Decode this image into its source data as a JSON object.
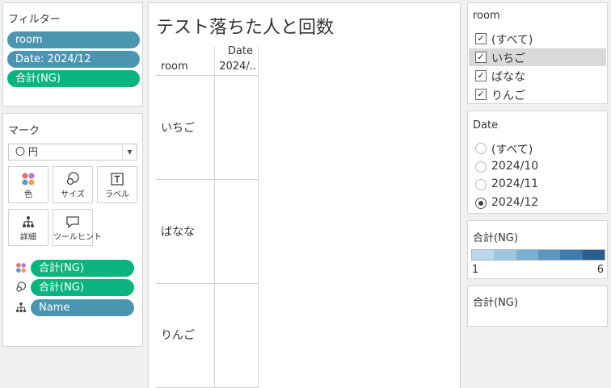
{
  "filters": {
    "title": "フィルター",
    "items": [
      "room",
      "Date: 2024/12",
      "合計(NG)"
    ]
  },
  "marks": {
    "title": "マーク",
    "mark_type": "〇 円",
    "cards": [
      "色",
      "サイズ",
      "ラベル",
      "詳細",
      "ツールヒント"
    ],
    "fields": [
      "合計(NG)",
      "合計(NG)",
      "Name"
    ]
  },
  "view": {
    "title": "テスト落ちた人と回数",
    "row_header": "room",
    "col_header_line1": "Date",
    "col_header_line2": "2024/..",
    "rows": [
      "いちご",
      "ばなな",
      "りんご"
    ]
  },
  "room_filter": {
    "title": "room",
    "options": [
      {
        "label": "(すべて)",
        "checked": true
      },
      {
        "label": "いちご",
        "checked": true
      },
      {
        "label": "ばなな",
        "checked": true
      },
      {
        "label": "りんご",
        "checked": true
      }
    ],
    "check_mark": "✓"
  },
  "date_filter": {
    "title": "Date",
    "options": [
      {
        "label": "(すべて)",
        "selected": false
      },
      {
        "label": "2024/10",
        "selected": false
      },
      {
        "label": "2024/11",
        "selected": false
      },
      {
        "label": "2024/12",
        "selected": true
      }
    ]
  },
  "color_legend": {
    "title": "合計(NG)",
    "min": "1",
    "max": "6",
    "colors": [
      "#b9d8ec",
      "#9cc7e0",
      "#7ab0d3",
      "#5b96c2",
      "#3e7bae",
      "#2a5f8f"
    ]
  },
  "size_legend": {
    "title": "合計(NG)"
  }
}
